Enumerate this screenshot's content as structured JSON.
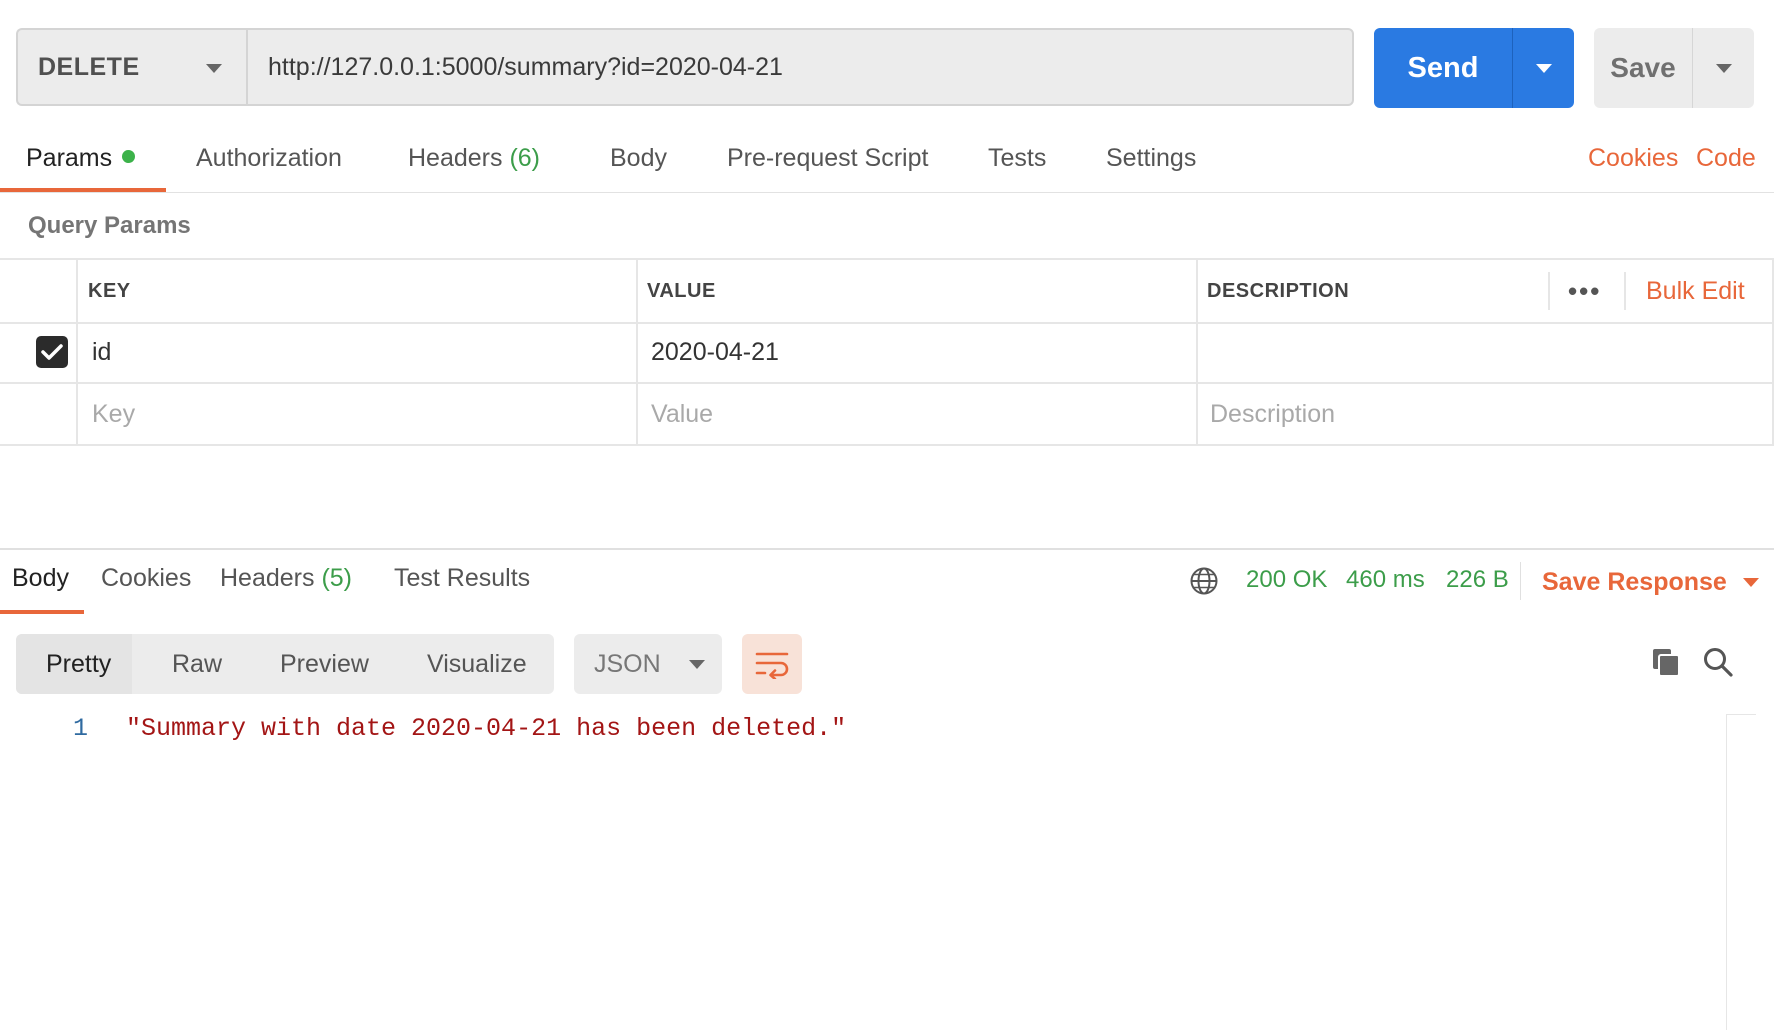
{
  "request": {
    "method": "DELETE",
    "url": "http://127.0.0.1:5000/summary?id=2020-04-21",
    "send_label": "Send",
    "save_label": "Save"
  },
  "request_tabs": {
    "params": "Params",
    "authorization": "Authorization",
    "headers": "Headers",
    "headers_count": "(6)",
    "body": "Body",
    "prerequest": "Pre-request Script",
    "tests": "Tests",
    "settings": "Settings",
    "cookies": "Cookies",
    "code": "Code"
  },
  "query_params": {
    "title": "Query Params",
    "headers": {
      "key": "KEY",
      "value": "VALUE",
      "description": "DESCRIPTION"
    },
    "bulk_edit": "Bulk Edit",
    "more": "•••",
    "rows": [
      {
        "enabled": true,
        "key": "id",
        "value": "2020-04-21",
        "description": ""
      }
    ],
    "placeholders": {
      "key": "Key",
      "value": "Value",
      "description": "Description"
    }
  },
  "response_tabs": {
    "body": "Body",
    "cookies": "Cookies",
    "headers": "Headers",
    "headers_count": "(5)",
    "test_results": "Test Results"
  },
  "response_meta": {
    "status": "200 OK",
    "time": "460 ms",
    "size": "226 B",
    "save_response": "Save Response",
    "status_color": "#3c9d4a"
  },
  "response_view": {
    "modes": [
      "Pretty",
      "Raw",
      "Preview",
      "Visualize"
    ],
    "active_mode": "Pretty",
    "format": "JSON"
  },
  "response_body": {
    "lines": [
      {
        "number": "1",
        "text": "\"Summary with date 2020-04-21 has been deleted.\""
      }
    ]
  },
  "colors": {
    "accent": "#e8673a",
    "primary": "#2a7ae2",
    "success": "#3c9d4a"
  },
  "icons": [
    "chevron-down-icon",
    "globe-icon",
    "wrap-lines-icon",
    "copy-icon",
    "search-icon",
    "checkmark-icon"
  ]
}
